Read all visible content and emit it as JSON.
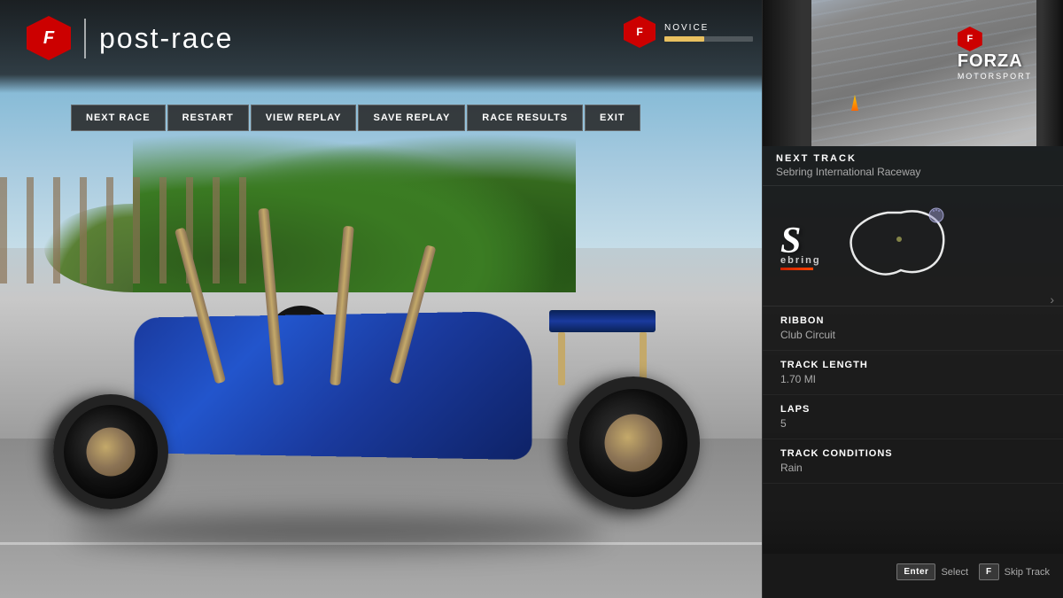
{
  "header": {
    "title": "post-race",
    "logo_label": "F",
    "divider": "|"
  },
  "nav": {
    "buttons": [
      {
        "id": "next-race",
        "label": "NEXT RACE"
      },
      {
        "id": "restart",
        "label": "RESTART"
      },
      {
        "id": "view-replay",
        "label": "VIEW REPLAY"
      },
      {
        "id": "save-replay",
        "label": "SAVE REPLAY"
      },
      {
        "id": "race-results",
        "label": "RACE RESULTS"
      },
      {
        "id": "exit",
        "label": "EXIT"
      }
    ]
  },
  "user": {
    "level": "NOVICE",
    "xp_percent": 45
  },
  "right_panel": {
    "next_track_section": {
      "label": "NEXT TRACK",
      "name": "Sebring International Raceway"
    },
    "sebring_logo_text": "Sebring",
    "track_details": [
      {
        "label": "RIBBON",
        "value": "Club Circuit"
      },
      {
        "label": "TRACK LENGTH",
        "value": "1.70 MI"
      },
      {
        "label": "LAPS",
        "value": "5"
      },
      {
        "label": "TRACK CONDITIONS",
        "value": "Rain"
      }
    ]
  },
  "bottom_controls": [
    {
      "key": "Enter",
      "label": "Select"
    },
    {
      "key": "F",
      "label": "Skip Track"
    }
  ]
}
